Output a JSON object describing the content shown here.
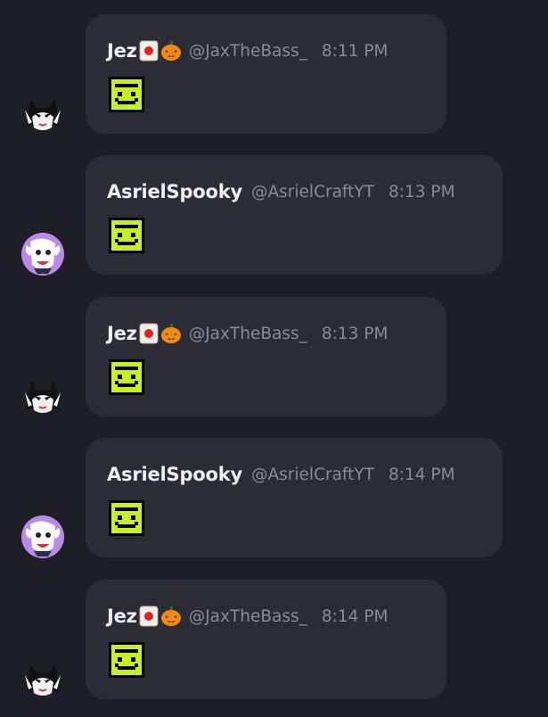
{
  "messages": [
    {
      "author": "Jez",
      "handle": "@JaxTheBass_",
      "time": "8:11 PM",
      "badges": [
        "mahjong-tile-icon",
        "jack-o-lantern-icon"
      ],
      "avatar": "black-white-cat-avatar",
      "content": "green-face-emote"
    },
    {
      "author": "AsrielSpooky",
      "handle": "@AsrielCraftYT",
      "time": "8:13 PM",
      "badges": [],
      "avatar": "purple-goat-avatar",
      "content": "green-face-emote"
    },
    {
      "author": "Jez",
      "handle": "@JaxTheBass_",
      "time": "8:13 PM",
      "badges": [
        "mahjong-tile-icon",
        "jack-o-lantern-icon"
      ],
      "avatar": "black-white-cat-avatar",
      "content": "green-face-emote"
    },
    {
      "author": "AsrielSpooky",
      "handle": "@AsrielCraftYT",
      "time": "8:14 PM",
      "badges": [],
      "avatar": "purple-goat-avatar",
      "content": "green-face-emote"
    },
    {
      "author": "Jez",
      "handle": "@JaxTheBass_",
      "time": "8:14 PM",
      "badges": [
        "mahjong-tile-icon",
        "jack-o-lantern-icon"
      ],
      "avatar": "black-white-cat-avatar",
      "content": "green-face-emote"
    }
  ],
  "colors": {
    "background": "#1e1e26",
    "bubble": "#2b2c36",
    "name": "#f1f1f4",
    "meta": "#8a8b96",
    "emote_green": "#c8f01e",
    "avatar_purple": "#b98ae6"
  }
}
